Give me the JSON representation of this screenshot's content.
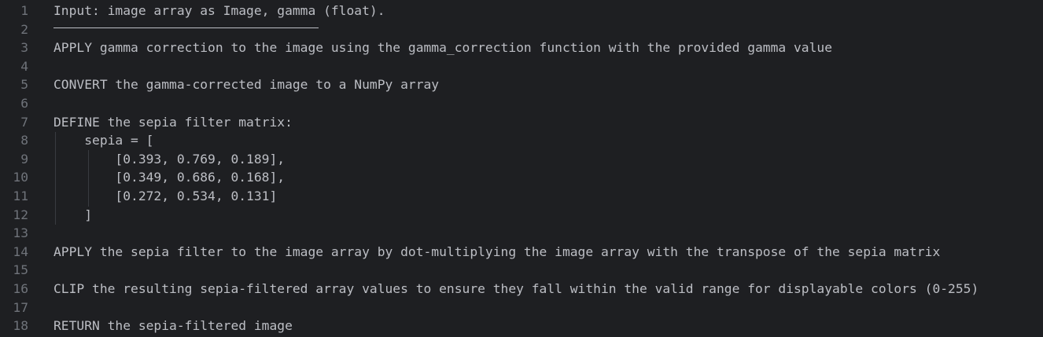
{
  "editor": {
    "lines": [
      {
        "number": "1",
        "text": "Input: image array as Image, gamma (float)."
      },
      {
        "number": "2",
        "text": ""
      },
      {
        "number": "3",
        "text": "APPLY gamma correction to the image using the gamma_correction function with the provided gamma value"
      },
      {
        "number": "4",
        "text": ""
      },
      {
        "number": "5",
        "text": "CONVERT the gamma-corrected image to a NumPy array"
      },
      {
        "number": "6",
        "text": ""
      },
      {
        "number": "7",
        "text": "DEFINE the sepia filter matrix:"
      },
      {
        "number": "8",
        "text": "    sepia = ["
      },
      {
        "number": "9",
        "text": "        [0.393, 0.769, 0.189],"
      },
      {
        "number": "10",
        "text": "        [0.349, 0.686, 0.168],"
      },
      {
        "number": "11",
        "text": "        [0.272, 0.534, 0.131]"
      },
      {
        "number": "12",
        "text": "    ]"
      },
      {
        "number": "13",
        "text": ""
      },
      {
        "number": "14",
        "text": "APPLY the sepia filter to the image array by dot-multiplying the image array with the transpose of the sepia matrix"
      },
      {
        "number": "15",
        "text": ""
      },
      {
        "number": "16",
        "text": "CLIP the resulting sepia-filtered array values to ensure they fall within the valid range for displayable colors (0-255)"
      },
      {
        "number": "17",
        "text": ""
      },
      {
        "number": "18",
        "text": "RETURN the sepia-filtered image"
      }
    ]
  }
}
